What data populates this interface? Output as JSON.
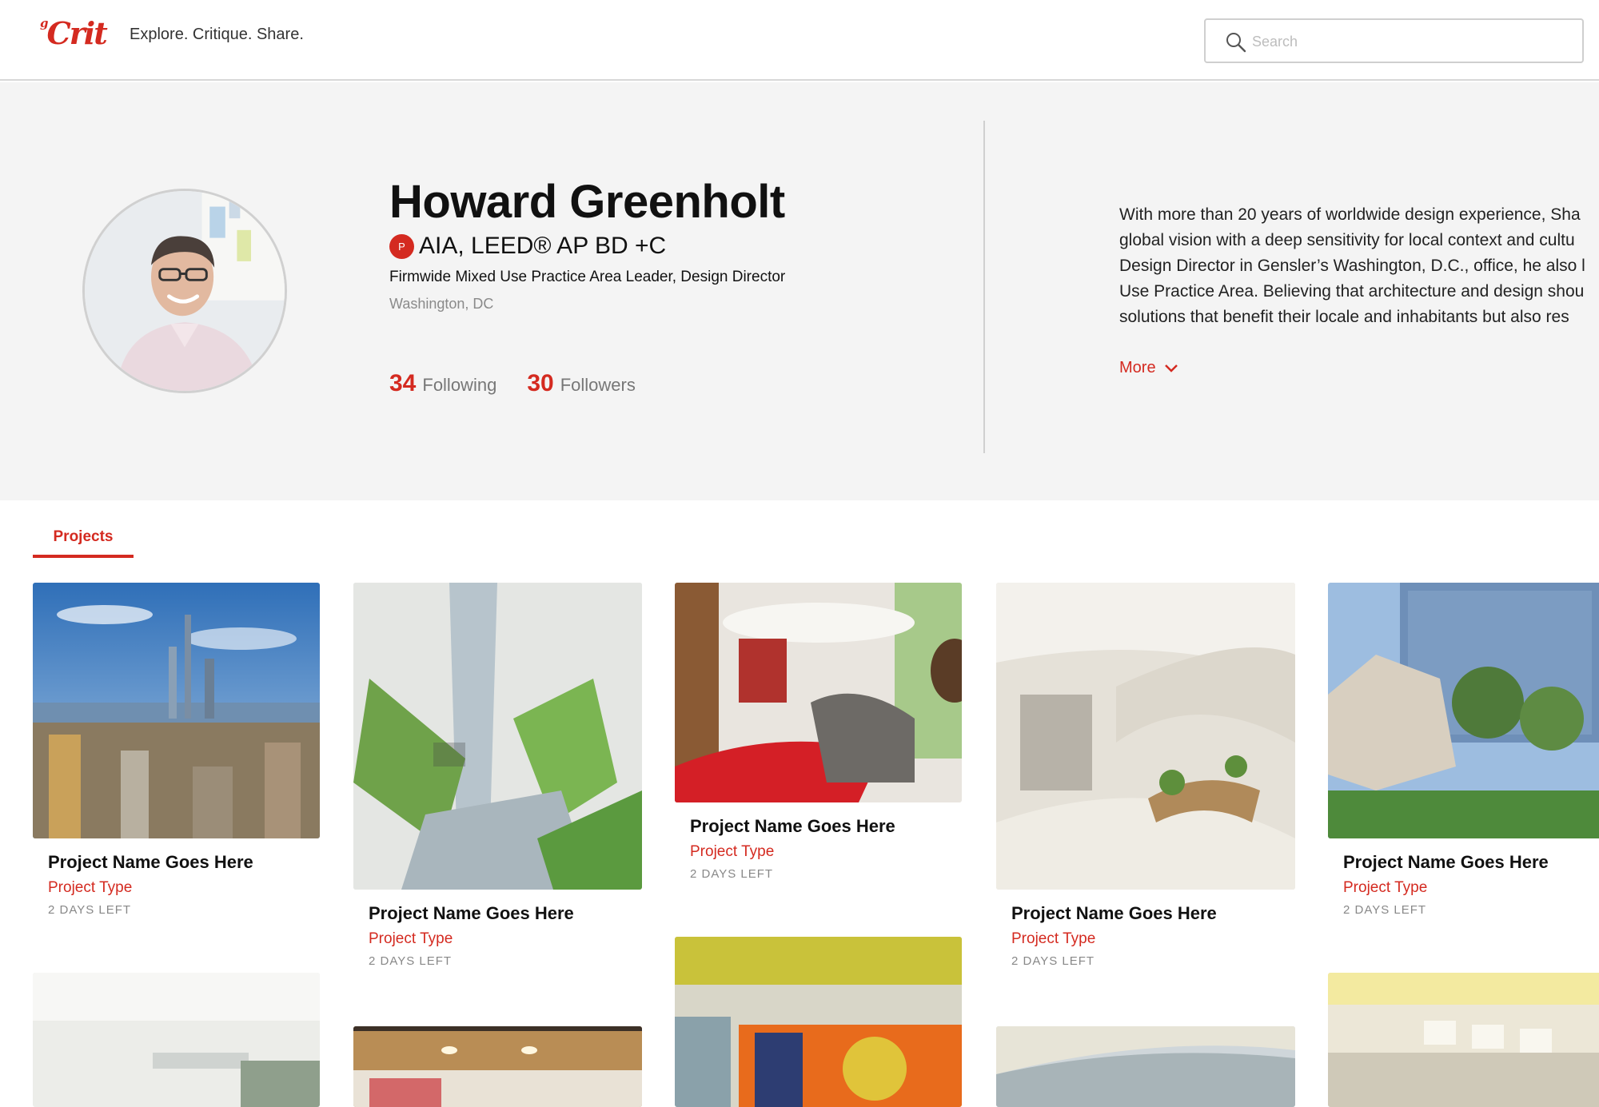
{
  "header": {
    "logo_small": "g",
    "logo_text": "Crit",
    "tagline": "Explore. Critique. Share.",
    "search_placeholder": "Search"
  },
  "profile": {
    "name": "Howard Greenholt",
    "badge_letter": "P",
    "credentials": "AIA, LEED® AP BD +C",
    "role": "Firmwide Mixed Use Practice Area Leader, Design Director",
    "location": "Washington, DC",
    "following_count": "34",
    "following_label": "Following",
    "followers_count": "30",
    "followers_label": "Followers",
    "bio_lines": [
      "With more than 20 years of worldwide design experience, Sha",
      "global vision with a deep sensitivity for local context and cultu",
      "Design Director in Gensler’s Washington, D.C., office, he also l",
      "Use Practice Area. Believing that architecture and design shou",
      "solutions that benefit their locale and inhabitants but also res"
    ],
    "more_label": "More"
  },
  "tabs": {
    "projects": "Projects"
  },
  "projects": [
    {
      "title": "Project Name Goes Here",
      "type": "Project Type",
      "time_left": "2 DAYS LEFT"
    },
    {
      "title": "Project Name Goes Here",
      "type": "Project Type",
      "time_left": "2 DAYS LEFT"
    },
    {
      "title": "Project Name Goes Here",
      "type": "Project Type",
      "time_left": "2 DAYS LEFT"
    },
    {
      "title": "Project Name Goes Here",
      "type": "Project Type",
      "time_left": "2 DAYS LEFT"
    },
    {
      "title": "Project Name Goes Here",
      "type": "Project Type",
      "time_left": "2 DAYS LEFT"
    }
  ],
  "colors": {
    "accent": "#d42a20",
    "profile_bg": "#f4f4f4"
  }
}
